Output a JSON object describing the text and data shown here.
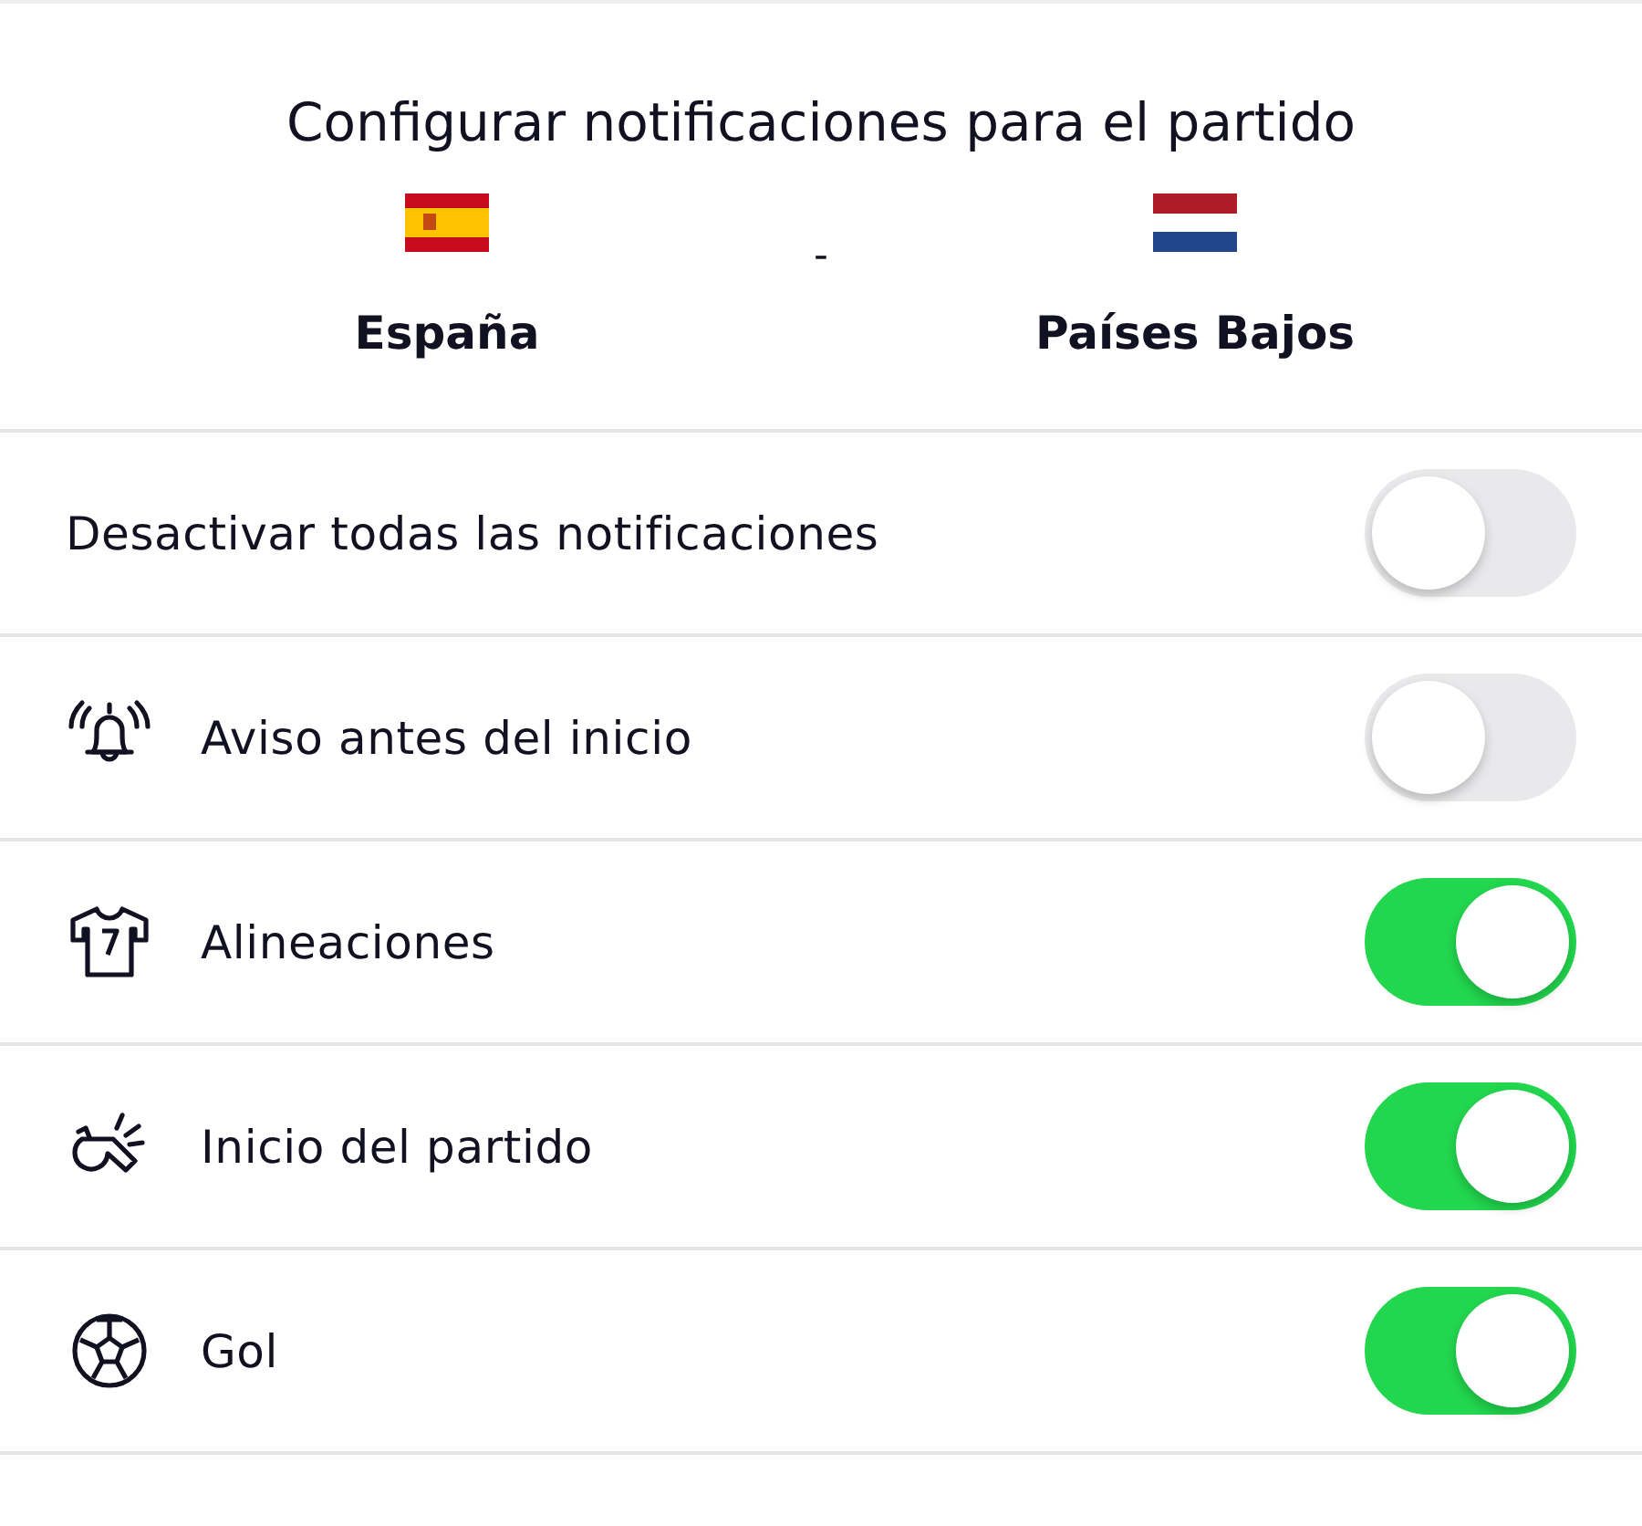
{
  "title": "Configurar notificaciones para el partido",
  "match": {
    "home": {
      "name": "España"
    },
    "separator": "-",
    "away": {
      "name": "Países Bajos"
    }
  },
  "settings": [
    {
      "label": "Desactivar todas las notificaciones",
      "on": false
    },
    {
      "label": "Aviso antes del inicio",
      "on": false
    },
    {
      "label": "Alineaciones",
      "on": true
    },
    {
      "label": "Inicio del partido",
      "on": true
    },
    {
      "label": "Gol",
      "on": true
    }
  ]
}
